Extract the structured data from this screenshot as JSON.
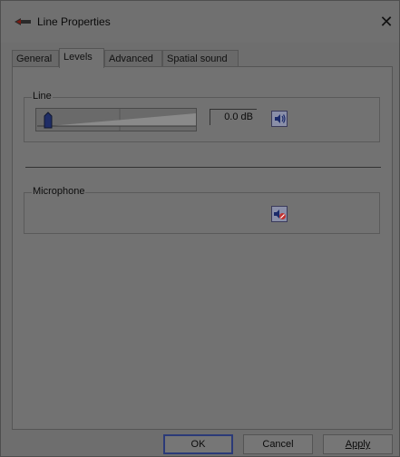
{
  "window": {
    "title": "Line Properties"
  },
  "tabs": [
    {
      "label": "General"
    },
    {
      "label": "Levels"
    },
    {
      "label": "Advanced"
    },
    {
      "label": "Spatial sound"
    }
  ],
  "line_group": {
    "label": "Line",
    "volume_readout": "0.0 dB",
    "volume_fraction": 0.0,
    "mute_state": "unmuted"
  },
  "mic_group": {
    "label": "Microphone",
    "mute_state": "muted"
  },
  "buttons": {
    "ok": "OK",
    "cancel": "Cancel",
    "apply": "Apply"
  },
  "colors": {
    "accent": "#2b3a78",
    "mute_red": "#c0302f"
  }
}
